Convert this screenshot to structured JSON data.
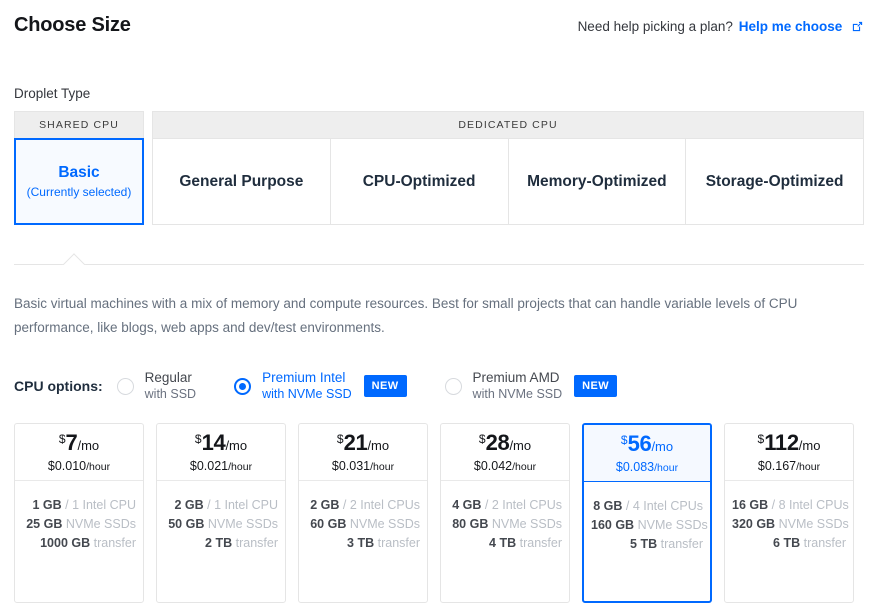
{
  "header": {
    "title": "Choose Size",
    "help_text": "Need help picking a plan?",
    "help_link": "Help me choose",
    "help_icon": "external-link-icon"
  },
  "droplet_type": {
    "label": "Droplet Type",
    "groups": [
      {
        "name": "SHARED CPU",
        "tabs": [
          {
            "label": "Basic",
            "sub": "(Currently selected)",
            "selected": true
          }
        ]
      },
      {
        "name": "DEDICATED CPU",
        "tabs": [
          {
            "label": "General Purpose",
            "selected": false
          },
          {
            "label": "CPU-Optimized",
            "selected": false
          },
          {
            "label": "Memory-Optimized",
            "selected": false
          },
          {
            "label": "Storage-Optimized",
            "selected": false
          }
        ]
      }
    ]
  },
  "description": "Basic virtual machines with a mix of memory and compute resources. Best for small projects that can handle variable levels of CPU performance, like blogs, web apps and dev/test environments.",
  "cpu_options": {
    "label": "CPU options:",
    "options": [
      {
        "name": "Regular",
        "storage": "with SSD",
        "selected": false,
        "badge": ""
      },
      {
        "name": "Premium Intel",
        "storage": "with NVMe SSD",
        "selected": true,
        "badge": "NEW"
      },
      {
        "name": "Premium AMD",
        "storage": "with NVMe SSD",
        "selected": false,
        "badge": "NEW"
      }
    ]
  },
  "accent_color": "#0069ff",
  "plans": [
    {
      "currency": "$",
      "monthly": "7",
      "per": "/mo",
      "hourly": "$0.010",
      "hourly_unit": "/hour",
      "memory": "1 GB",
      "cpu": "/ 1 Intel CPU",
      "disk": "25 GB",
      "disk_unit": "NVMe SSDs",
      "transfer": "1000 GB",
      "transfer_unit": "transfer",
      "selected": false
    },
    {
      "currency": "$",
      "monthly": "14",
      "per": "/mo",
      "hourly": "$0.021",
      "hourly_unit": "/hour",
      "memory": "2 GB",
      "cpu": "/ 1 Intel CPU",
      "disk": "50 GB",
      "disk_unit": "NVMe SSDs",
      "transfer": "2 TB",
      "transfer_unit": "transfer",
      "selected": false
    },
    {
      "currency": "$",
      "monthly": "21",
      "per": "/mo",
      "hourly": "$0.031",
      "hourly_unit": "/hour",
      "memory": "2 GB",
      "cpu": "/ 2 Intel CPUs",
      "disk": "60 GB",
      "disk_unit": "NVMe SSDs",
      "transfer": "3 TB",
      "transfer_unit": "transfer",
      "selected": false
    },
    {
      "currency": "$",
      "monthly": "28",
      "per": "/mo",
      "hourly": "$0.042",
      "hourly_unit": "/hour",
      "memory": "4 GB",
      "cpu": "/ 2 Intel CPUs",
      "disk": "80 GB",
      "disk_unit": "NVMe SSDs",
      "transfer": "4 TB",
      "transfer_unit": "transfer",
      "selected": false
    },
    {
      "currency": "$",
      "monthly": "56",
      "per": "/mo",
      "hourly": "$0.083",
      "hourly_unit": "/hour",
      "memory": "8 GB",
      "cpu": "/ 4 Intel CPUs",
      "disk": "160 GB",
      "disk_unit": "NVMe SSDs",
      "transfer": "5 TB",
      "transfer_unit": "transfer",
      "selected": true
    },
    {
      "currency": "$",
      "monthly": "112",
      "per": "/mo",
      "hourly": "$0.167",
      "hourly_unit": "/hour",
      "memory": "16 GB",
      "cpu": "/ 8 Intel CPUs",
      "disk": "320 GB",
      "disk_unit": "NVMe SSDs",
      "transfer": "6 TB",
      "transfer_unit": "transfer",
      "selected": false
    }
  ]
}
